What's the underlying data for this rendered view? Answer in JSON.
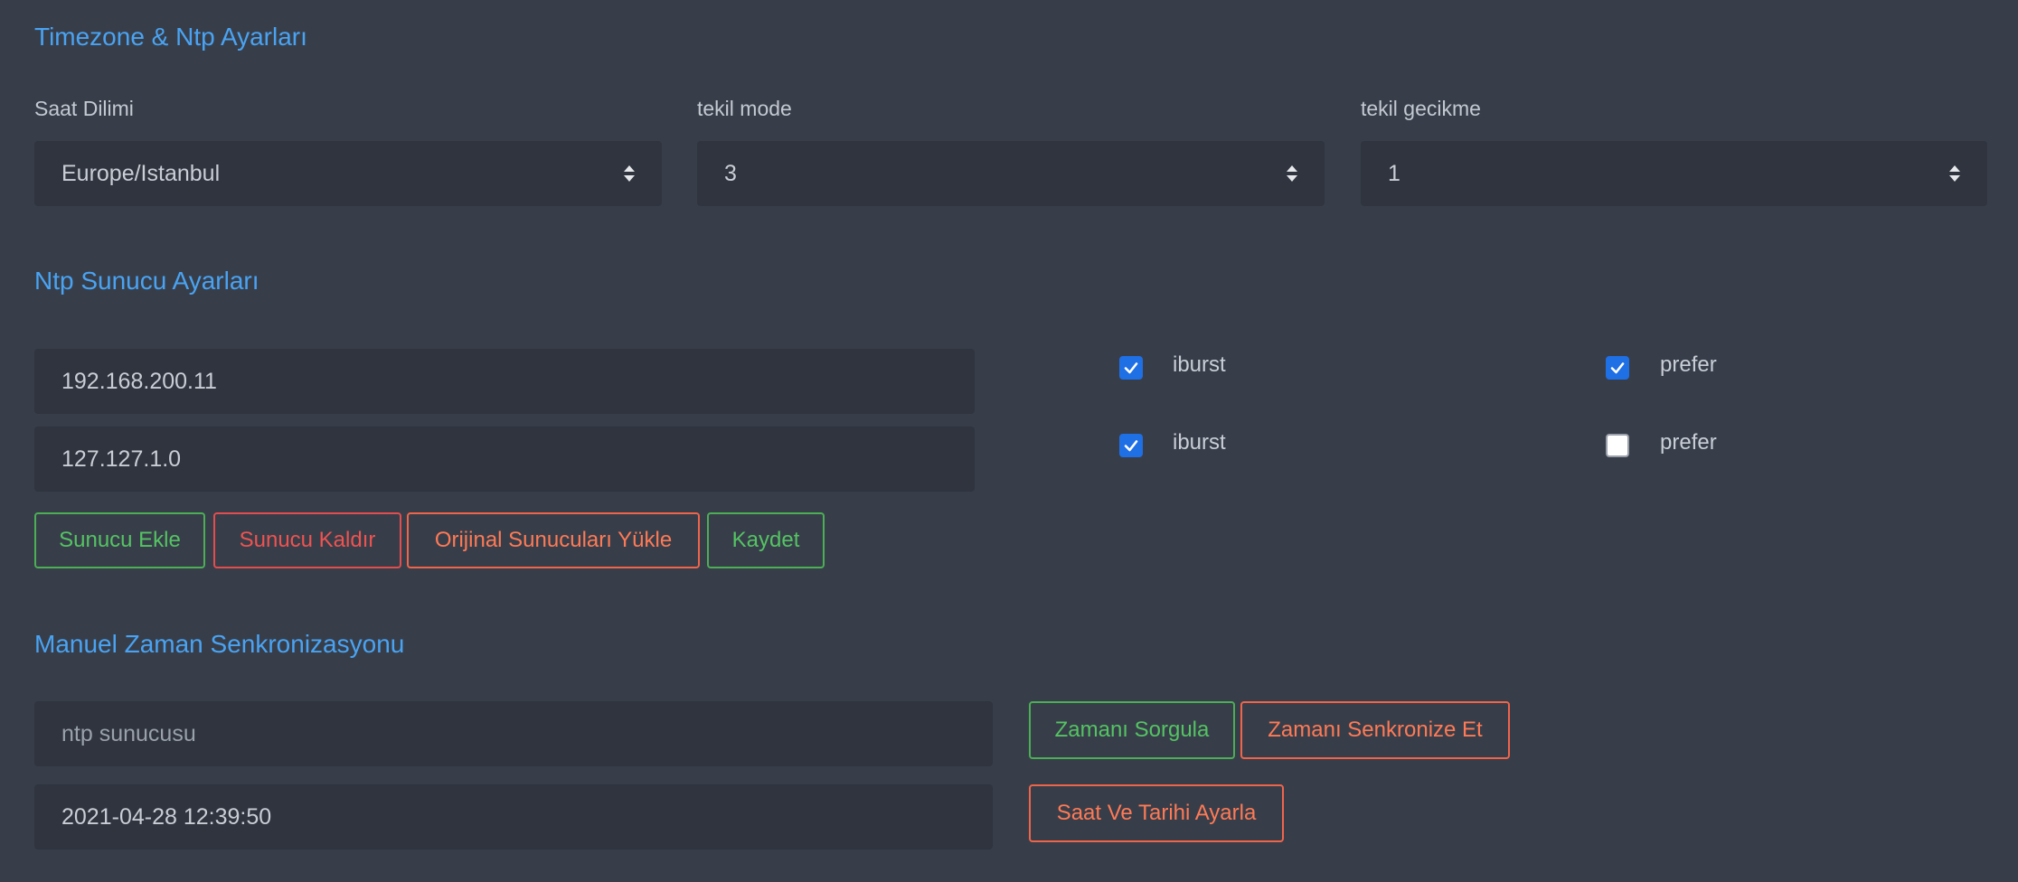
{
  "timezone_section": {
    "title": "Timezone & Ntp Ayarları",
    "fields": [
      {
        "label": "Saat Dilimi",
        "value": "Europe/Istanbul",
        "icon": "sort-chevrons-icon"
      },
      {
        "label": "tekil mode",
        "value": "3",
        "icon": "sort-chevrons-icon"
      },
      {
        "label": "tekil gecikme",
        "value": "1",
        "icon": "sort-chevrons-icon"
      }
    ]
  },
  "ntp_section": {
    "title": "Ntp Sunucu Ayarları",
    "servers": [
      {
        "address": "192.168.200.11",
        "iburst_label": "iburst",
        "iburst_checked": true,
        "prefer_label": "prefer",
        "prefer_checked": true
      },
      {
        "address": "127.127.1.0",
        "iburst_label": "iburst",
        "iburst_checked": true,
        "prefer_label": "prefer",
        "prefer_checked": false
      }
    ],
    "buttons": {
      "add": "Sunucu Ekle",
      "remove": "Sunucu Kaldır",
      "load_original": "Orijinal Sunucuları Yükle",
      "save": "Kaydet"
    }
  },
  "manual_section": {
    "title": "Manuel Zaman Senkronizasyonu",
    "ntp_server_placeholder": "ntp sunucusu",
    "datetime_value": "2021-04-28 12:39:50",
    "buttons": {
      "query": "Zamanı Sorgula",
      "sync": "Zamanı Senkronize Et",
      "set_datetime": "Saat Ve Tarihi Ayarla"
    }
  },
  "colors": {
    "background": "#373e4a",
    "field_bg": "#2f343e",
    "title": "#4aa3f2",
    "green": "#55c363",
    "red": "#ef5350",
    "orange": "#ff7a55",
    "checkbox_checked": "#1f6fe5"
  }
}
